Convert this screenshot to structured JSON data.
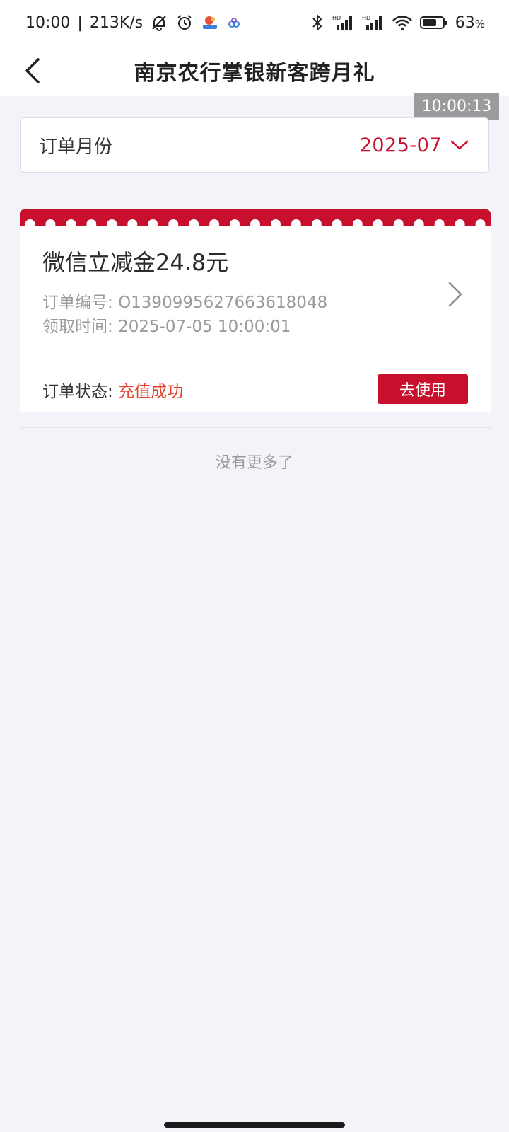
{
  "status_bar": {
    "time": "10:00",
    "separator": "|",
    "net_speed": "213K/s",
    "battery": "63",
    "battery_unit": "%",
    "icons": [
      "bell-off-icon",
      "alarm-icon",
      "app-badge-icon",
      "cloud-app-icon",
      "bluetooth-icon",
      "hd-signal-icon",
      "hd-signal-icon",
      "wifi-icon",
      "battery-icon"
    ]
  },
  "header": {
    "title": "南京农行掌银新客跨月礼",
    "back_icon": "chevron-left-icon"
  },
  "overlay": {
    "time": "10:00:13"
  },
  "filter": {
    "label": "订单月份",
    "value": "2025-07",
    "icon": "chevron-down-icon"
  },
  "order": {
    "title": "微信立减金24.8元",
    "order_no_label": "订单编号:",
    "order_no": "O1390995627663618048",
    "claim_time_label": "领取时间:",
    "claim_time": "2025-07-05 10:00:01",
    "status_label": "订单状态:",
    "status_value": "充值成功",
    "action_label": "去使用"
  },
  "list": {
    "end_text": "没有更多了"
  },
  "colors": {
    "accent": "#c8102e",
    "status_success": "#e0442b",
    "background": "#f3f4f9"
  }
}
